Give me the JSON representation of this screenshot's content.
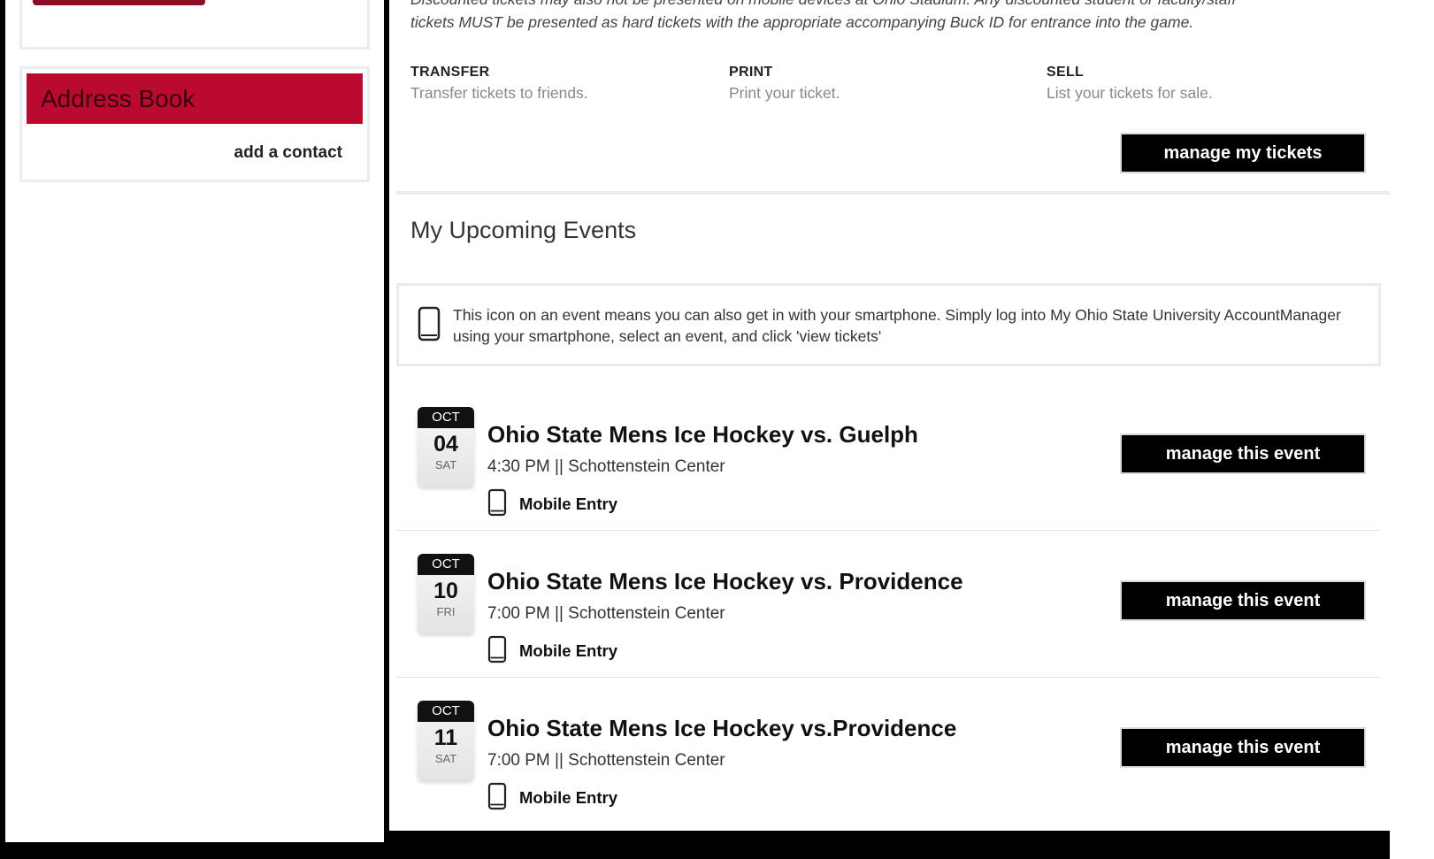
{
  "sidebar": {
    "address_book": {
      "title": "Address Book",
      "add_contact_label": "add a contact"
    }
  },
  "main": {
    "notice_lines": [
      "Discounted tickets may also not be presented on mobile devices at Ohio Stadium.  Any discounted student or faculty/staff",
      "tickets MUST be presented as hard tickets with the appropriate accompanying Buck ID for entrance into the game."
    ],
    "ticket_options": [
      {
        "title": "TRANSFER",
        "description": "Transfer tickets to friends."
      },
      {
        "title": "PRINT",
        "description": "Print your ticket."
      },
      {
        "title": "SELL",
        "description": "List your tickets for sale."
      }
    ],
    "manage_tickets_label": "manage my tickets",
    "upcoming_title": "My Upcoming Events",
    "mobile_info_text": "This icon on an event means you can also get in with your smartphone. Simply log into My Ohio State University AccountManager using your smartphone, select an event, and click 'view tickets'",
    "events": [
      {
        "month": "OCT",
        "day": "04",
        "weekday": "SAT",
        "title": "Ohio State Mens Ice Hockey vs. Guelph",
        "details": "4:30 PM || Schottenstein Center",
        "mobile_label": "Mobile Entry",
        "manage_label": "manage this event"
      },
      {
        "month": "OCT",
        "day": "10",
        "weekday": "FRI",
        "title": "Ohio State Mens Ice Hockey vs. Providence",
        "details": "7:00 PM || Schottenstein Center",
        "mobile_label": "Mobile Entry",
        "manage_label": "manage this event"
      },
      {
        "month": "OCT",
        "day": "11",
        "weekday": "SAT",
        "title": "Ohio State Mens Ice Hockey vs.Providence",
        "details": "7:00 PM || Schottenstein Center",
        "mobile_label": "Mobile Entry",
        "manage_label": "manage this event"
      }
    ]
  },
  "icons": {
    "mobile": "smartphone-icon"
  },
  "colors": {
    "brand_red": "#bb0a30",
    "button_black": "#000000"
  }
}
